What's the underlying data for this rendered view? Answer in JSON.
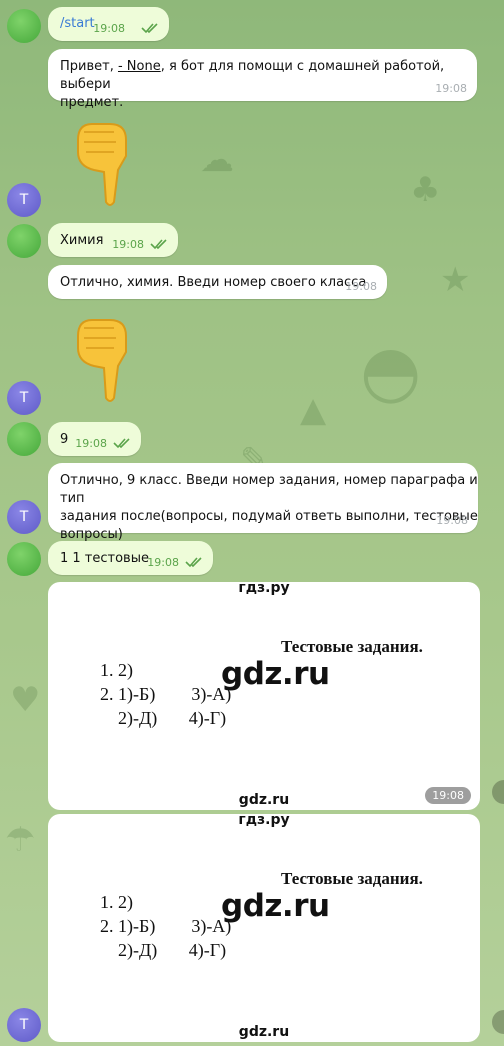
{
  "chat": {
    "avatar_user_letter": "",
    "avatar_bot_letter": "T",
    "messages": [
      {
        "type": "out",
        "text": "/start",
        "time": "19:08"
      },
      {
        "type": "in",
        "text_prefix": "Привет, ",
        "mention": "- None",
        "text_suffix": ", я бот для помощи с домашней работой, выбери",
        "text_line2": "предмет.",
        "time": "19:08"
      },
      {
        "type": "sticker",
        "icon": "pointing-down-hand"
      },
      {
        "type": "out",
        "text": "Химия",
        "time": "19:08"
      },
      {
        "type": "in",
        "text": "Отлично, химия. Введи номер своего класса",
        "time": "19:08"
      },
      {
        "type": "sticker",
        "icon": "pointing-down-hand"
      },
      {
        "type": "out",
        "text": "9",
        "time": "19:08"
      },
      {
        "type": "in",
        "line1": "Отлично, 9 класс. Введи номер задания, номер параграфа и тип",
        "line2": "задания после(вопросы, подумай ответь выполни, тестовые",
        "line3": "вопросы)",
        "time": "19:08"
      },
      {
        "type": "out",
        "text": "1 1 тестовые",
        "time": "19:08"
      }
    ],
    "photos": [
      {
        "watermark_top": "гдз.ру",
        "title": "Тестовые задания.",
        "line1": "1. 2)",
        "line2": "2. 1)-Б)        3)-А)",
        "line3": "2)-Д)       4)-Г)",
        "watermark_big": "gdz.ru",
        "watermark_bottom": "gdz.ru",
        "time": "19:08"
      },
      {
        "watermark_top": "гдз.ру",
        "title": "Тестовые задания.",
        "line1": "1. 2)",
        "line2": "2. 1)-Б)        3)-А)",
        "line3": "2)-Д)       4)-Г)",
        "watermark_big": "gdz.ru",
        "watermark_bottom": "gdz.ru"
      }
    ]
  },
  "colors": {
    "outgoing_bubble": "#eefcd9",
    "incoming_bubble": "#ffffff",
    "check_color": "#5ba44b",
    "command_link": "#3a7bd5"
  }
}
